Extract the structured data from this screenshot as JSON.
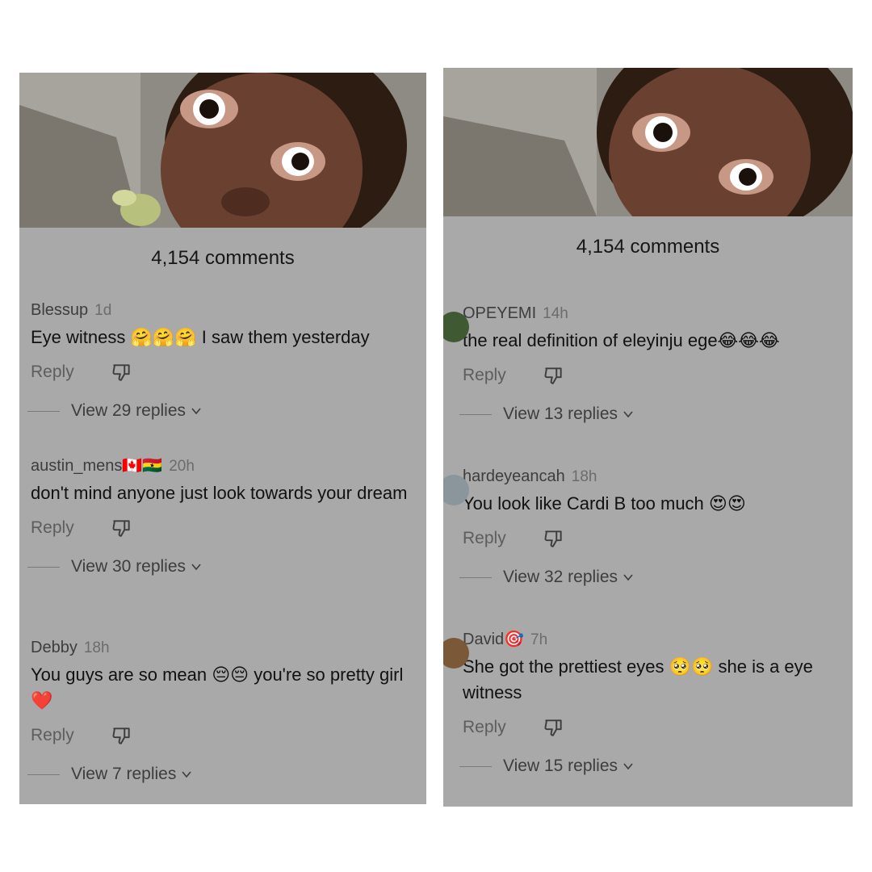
{
  "panels": [
    {
      "title": "4,154 comments",
      "comments": [
        {
          "user": "Blessup",
          "time": "1d",
          "text": "Eye witness 🤗🤗🤗 I saw them yesterday",
          "reply_label": "Reply",
          "view_label": "View 29 replies"
        },
        {
          "user": "austin_mens🇨🇦🇬🇭",
          "time": "20h",
          "text": "don't mind anyone just look towards your dream",
          "reply_label": "Reply",
          "view_label": "View 30 replies"
        },
        {
          "user": "Debby",
          "time": "18h",
          "text": "You guys are so mean 😔😔 you're so pretty girl ❤️",
          "reply_label": "Reply",
          "view_label": "View 7 replies"
        }
      ]
    },
    {
      "title": "4,154 comments",
      "comments": [
        {
          "user": "OPEYEMI",
          "time": "14h",
          "text": "the real definition of eleyinju ege😂😂😂",
          "reply_label": "Reply",
          "view_label": "View 13 replies"
        },
        {
          "user": "hardeyeancah",
          "time": "18h",
          "text": "You look like Cardi B too much 😍😍",
          "reply_label": "Reply",
          "view_label": "View 32 replies"
        },
        {
          "user": "David🎯",
          "time": "7h",
          "text": "She got the prettiest eyes 🥺🥺 she is a eye witness",
          "reply_label": "Reply",
          "view_label": "View 15 replies"
        }
      ]
    }
  ],
  "colors": {
    "panel_bg": "#a9a9a9",
    "text_primary": "#111111",
    "text_secondary": "#5d5d5d"
  },
  "icons": {
    "dislike": "thumbs-down-icon",
    "expand": "chevron-down-icon"
  }
}
